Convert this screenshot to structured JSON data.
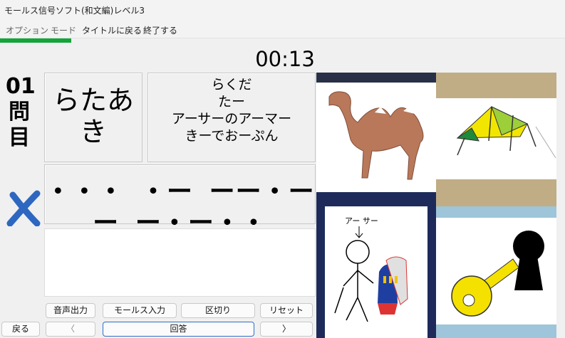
{
  "window": {
    "title": "モールス信号ソフト(和文編)レベル3"
  },
  "menu": {
    "options": "オプション",
    "mode": "モード",
    "back_to_title": "タイトルに戻る",
    "quit": "終了する"
  },
  "progress": {
    "fraction": 0.126,
    "color": "#11a53a"
  },
  "timer": "00:13",
  "question": {
    "number_label": "01\n問\n目"
  },
  "answer_panel": {
    "text": "らたあ\nき"
  },
  "hint_panel": {
    "text": "らくだ\nたー\nアーサーのアーマー\nきーでおーぷん"
  },
  "morse": {
    "text": "・・・ ・ー ーー・ーー ー・ー・・"
  },
  "input": {
    "value": ""
  },
  "status": {
    "result_icon": "x-icon",
    "color": "#2e67c0"
  },
  "buttons": {
    "audio": "音声出力",
    "morse_input": "モールス入力",
    "separator": "区切り",
    "reset": "リセット",
    "back": "戻る",
    "prev": "〈",
    "answer": "回答",
    "next": "〉"
  },
  "images": [
    {
      "name": "camel-image",
      "icon": "camel-icon"
    },
    {
      "name": "tent-image",
      "icon": "tent-icon"
    },
    {
      "name": "arthur-image",
      "icon": "arthur-icon",
      "caption": "アーサー"
    },
    {
      "name": "key-image",
      "icon": "key-icon"
    }
  ]
}
